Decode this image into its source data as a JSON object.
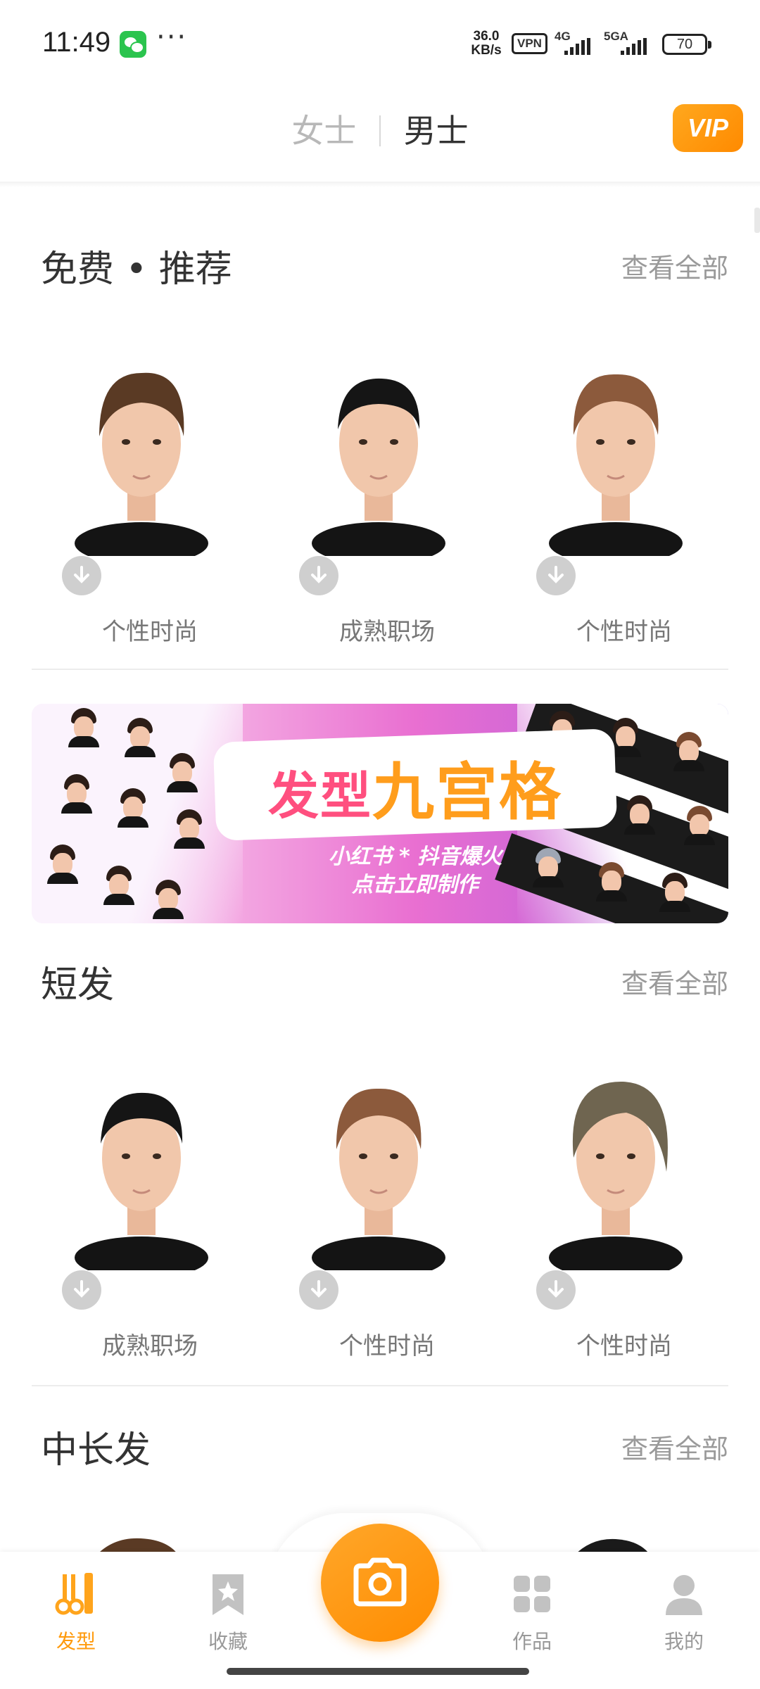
{
  "status_bar": {
    "time": "11:49",
    "net_speed_value": "36.0",
    "net_speed_unit": "KB/s",
    "vpn": "VPN",
    "signal_1": "4G",
    "signal_2": "5GA",
    "battery": "70"
  },
  "header": {
    "tab_women": "女士",
    "tab_men": "男士",
    "active_tab": "男士",
    "vip": "VIP"
  },
  "sections": [
    {
      "title": "免费 • 推荐",
      "view_all": "查看全部",
      "items": [
        {
          "label": "个性时尚",
          "hair_color": "#5a3a24"
        },
        {
          "label": "成熟职场",
          "hair_color": "#151515"
        },
        {
          "label": "个性时尚",
          "hair_color": "#8c5a3c"
        }
      ]
    },
    {
      "title": "短发",
      "view_all": "查看全部",
      "items": [
        {
          "label": "成熟职场",
          "hair_color": "#151515"
        },
        {
          "label": "个性时尚",
          "hair_color": "#8c5a3c"
        },
        {
          "label": "个性时尚",
          "hair_color": "#6f6550"
        }
      ]
    },
    {
      "title": "中长发",
      "view_all": "查看全部"
    }
  ],
  "banner": {
    "title_prefix": "发型",
    "title_main": "九宫格",
    "subtitle_line1": "小红书 * 抖音爆火",
    "subtitle_line2": "点击立即制作"
  },
  "bottom_nav": {
    "items": [
      {
        "label": "发型",
        "icon": "scissors-comb-icon",
        "active": true
      },
      {
        "label": "收藏",
        "icon": "bookmark-star-icon",
        "active": false
      },
      {
        "label": "作品",
        "icon": "grid-icon",
        "active": false
      },
      {
        "label": "我的",
        "icon": "person-icon",
        "active": false
      }
    ],
    "center_icon": "camera-icon"
  },
  "colors": {
    "accent": "#ff9a0c",
    "text_primary": "#333333",
    "text_secondary": "#9a9a9a"
  }
}
